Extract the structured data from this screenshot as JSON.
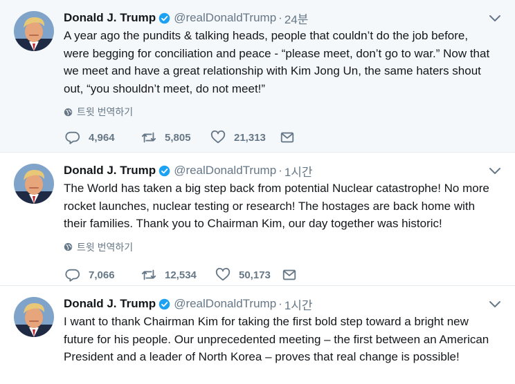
{
  "tweets": [
    {
      "name": "Donald J. Trump",
      "handle": "@realDonaldTrump",
      "separator": "·",
      "time": "24분",
      "text": "A year ago the pundits & talking heads, people that couldn’t do the job before, were begging for conciliation and peace - “please meet, don’t go to war.” Now that we meet and have a great relationship with Kim Jong Un, the same haters shout out, “you shouldn’t meet, do not meet!”",
      "translate_label": "트윗 번역하기",
      "replies": "4,964",
      "retweets": "5,805",
      "likes": "21,313"
    },
    {
      "name": "Donald J. Trump",
      "handle": "@realDonaldTrump",
      "separator": "·",
      "time": "1시간",
      "text": "The World has taken a big step back from potential Nuclear catastrophe! No more rocket launches, nuclear testing or research! The hostages are back home with their families. Thank you to Chairman Kim, our day together was historic!",
      "translate_label": "트윗 번역하기",
      "replies": "7,066",
      "retweets": "12,534",
      "likes": "50,173"
    },
    {
      "name": "Donald J. Trump",
      "handle": "@realDonaldTrump",
      "separator": "·",
      "time": "1시간",
      "text": "I want to thank Chairman Kim for taking the first bold step toward a bright new future for his people. Our unprecedented meeting – the first between an American President and a leader of North Korea – proves that real change is possible!"
    }
  ],
  "icons": {
    "verified": "verified-badge-icon",
    "caret": "chevron-down-icon",
    "globe": "globe-icon",
    "reply": "reply-icon",
    "retweet": "retweet-icon",
    "like": "heart-icon",
    "dm": "envelope-icon"
  },
  "colors": {
    "highlight_bg": "#f5f8fa",
    "verified_blue": "#1da1f2",
    "secondary_text": "#657786"
  }
}
